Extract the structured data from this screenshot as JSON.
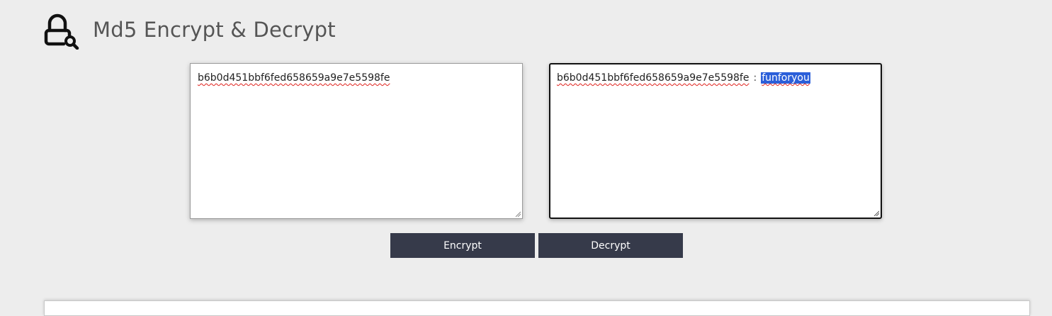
{
  "header": {
    "title": "Md5 Encrypt & Decrypt",
    "icon": "lock-search-icon"
  },
  "input_box": {
    "value": "b6b0d451bbf6fed658659a9e7e5598fe"
  },
  "output_box": {
    "hash": "b6b0d451bbf6fed658659a9e7e5598fe",
    "separator": ":",
    "result": "funforyou"
  },
  "buttons": {
    "encrypt_label": "Encrypt",
    "decrypt_label": "Decrypt"
  },
  "colors": {
    "background": "#ededed",
    "button": "#363a4a",
    "title": "#555555",
    "selection": "#2b5fd9"
  }
}
